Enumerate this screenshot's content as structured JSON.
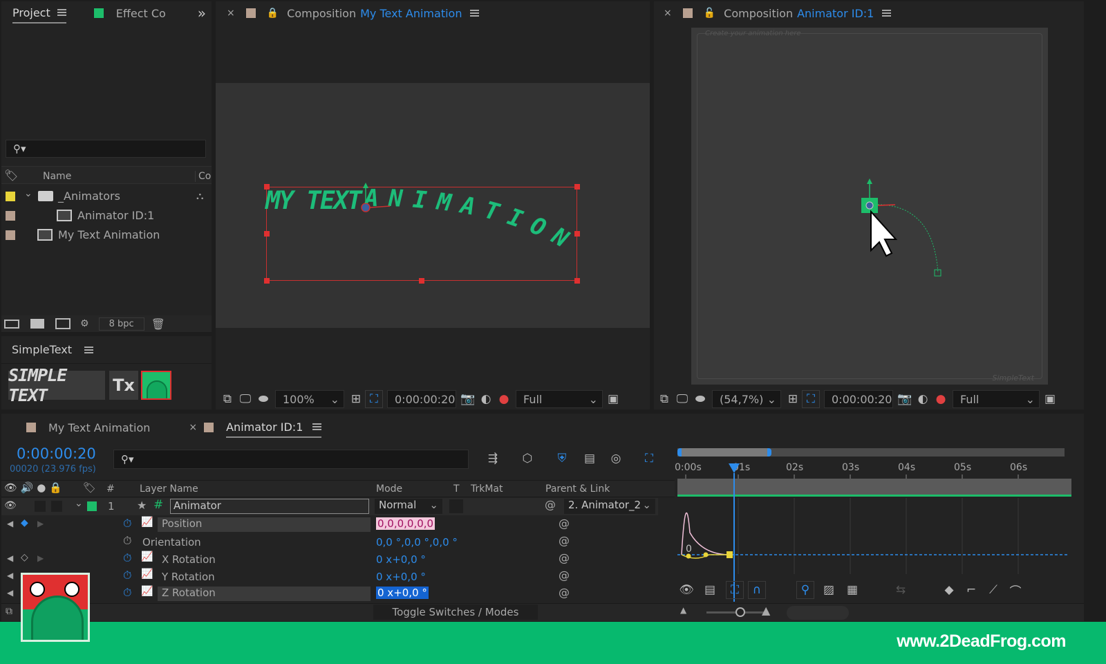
{
  "project_panel": {
    "tab_project": "Project",
    "tab_effects": "Effect Co",
    "overflow": "»",
    "search_placeholder": "",
    "col_name": "Name",
    "col_comment": "Com",
    "items": [
      {
        "name": "_Animators",
        "type": "folder",
        "color": "#e8d43a"
      },
      {
        "name": "Animator ID:1",
        "type": "comp",
        "color": "#b8a090"
      },
      {
        "name": "My Text Animation",
        "type": "comp",
        "color": "#b8a090"
      }
    ],
    "bpc": "8 bpc"
  },
  "simpletext_panel": {
    "title": "SimpleText",
    "logo_text": "SIMPLE TEXT",
    "tx_icon": "Tx"
  },
  "comp_left": {
    "label": "Composition",
    "name": "My Text Animation",
    "text_part1": "MY TEXT",
    "text_part2": "ANIMATION",
    "zoom": "100%",
    "timecode": "0:00:00:20",
    "quality": "Full"
  },
  "comp_right": {
    "label": "Composition",
    "name": "Animator ID:1",
    "hint": "Create your animation here",
    "watermark": "SimpleText",
    "zoom": "(54,7%)",
    "timecode": "0:00:00:20",
    "quality": "Full"
  },
  "timeline": {
    "tabs": [
      {
        "label": "My Text Animation"
      },
      {
        "label": "Animator ID:1"
      }
    ],
    "current_time": "0:00:00:20",
    "frame_info": "00020 (23.976 fps)",
    "columns": {
      "num": "#",
      "layer_name": "Layer Name",
      "mode": "Mode",
      "t": "T",
      "trkmat": "TrkMat",
      "parent": "Parent & Link"
    },
    "layer": {
      "index": "1",
      "name": "Animator",
      "mode": "Normal",
      "parent": "2. Animator_2"
    },
    "properties": [
      {
        "name": "Position",
        "value": "0,0,0,0,0,0"
      },
      {
        "name": "Orientation",
        "value": "0,0 °,0,0 °,0,0 °"
      },
      {
        "name": "X Rotation",
        "value": "0 x+0,0 °"
      },
      {
        "name": "Y Rotation",
        "value": "0 x+0,0 °"
      },
      {
        "name": "Z Rotation",
        "value": "0 x+0,0 °"
      }
    ],
    "ruler": [
      "0:00s",
      "01s",
      "02s",
      "03s",
      "04s",
      "05s",
      "06s"
    ],
    "graph_label": "0",
    "toggle_label": "Toggle Switches / Modes"
  },
  "footer": {
    "url": "www.2DeadFrog.com"
  },
  "colors": {
    "accent_blue": "#2d8ceb",
    "text_green": "#1dbd7a",
    "brand_green": "#07b96e",
    "handle_red": "#e03030"
  }
}
